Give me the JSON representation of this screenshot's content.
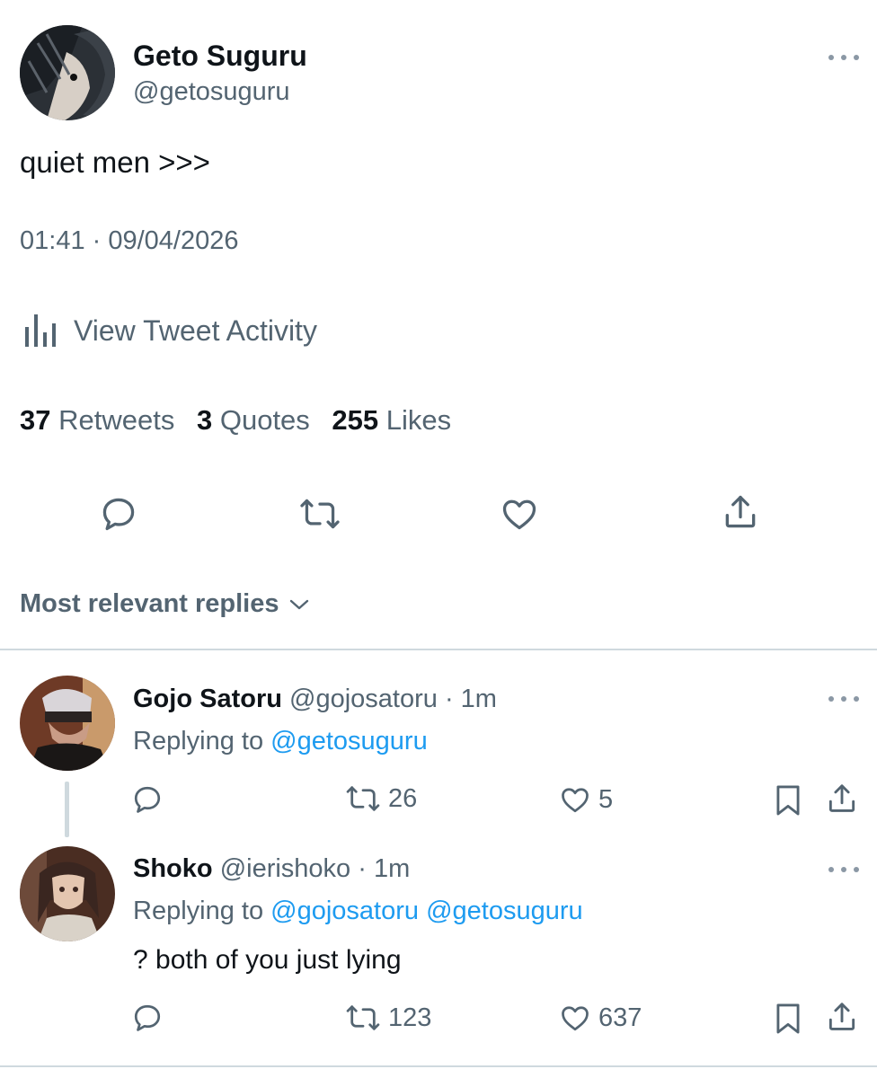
{
  "tweet": {
    "author_name": "Geto Suguru",
    "author_handle": "@getosuguru",
    "text": "quiet men >>>",
    "timestamp": "01:41 · 09/04/2026",
    "activity_label": "View Tweet Activity",
    "stats": {
      "retweets_count": "37",
      "retweets_label": "Retweets",
      "quotes_count": "3",
      "quotes_label": "Quotes",
      "likes_count": "255",
      "likes_label": "Likes"
    },
    "icons": [
      "reply-icon",
      "retweet-icon",
      "like-icon",
      "share-icon"
    ]
  },
  "replies_header": {
    "label": "Most relevant replies"
  },
  "replies": [
    {
      "name": "Gojo Satoru",
      "handle": "@gojosatoru",
      "time": "· 1m",
      "replying_prefix": "Replying to",
      "replying_to": "@getosuguru",
      "text": "",
      "retweets": "26",
      "likes": "5"
    },
    {
      "name": "Shoko",
      "handle": "@ierishoko",
      "time": "· 1m",
      "replying_prefix": "Replying to",
      "replying_to": "@gojosatoru @getosuguru",
      "text": "? both of you just lying",
      "retweets": "123",
      "likes": "637"
    }
  ],
  "colors": {
    "text": "#0f1419",
    "secondary": "#536471",
    "accent": "#1d9bf0",
    "divider": "#cfd9de"
  }
}
